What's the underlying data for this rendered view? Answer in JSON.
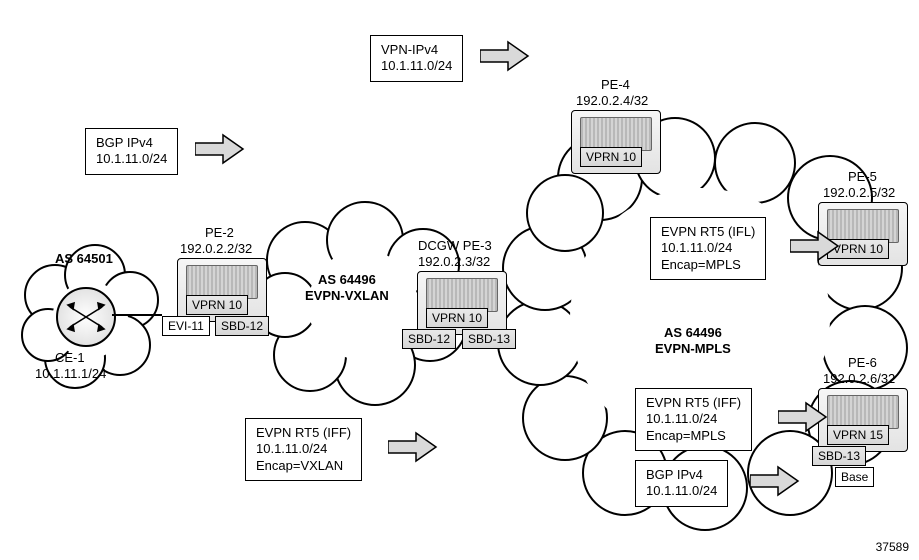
{
  "doc_id": "37589",
  "as": {
    "left": "AS 64501",
    "mid": "AS 64496\nEVPN-VXLAN",
    "right": "AS 64496\nEVPN-MPLS"
  },
  "nodes": {
    "ce1": {
      "name": "CE-1",
      "addr": "10.1.11.1/24"
    },
    "pe2": {
      "name": "PE-2",
      "addr": "192.0.2.2/32",
      "badges": {
        "vprn": "VPRN 10",
        "evi": "EVI-11",
        "sbd": "SBD-12"
      }
    },
    "pe3": {
      "name": "DCGW PE-3",
      "addr": "192.0.2.3/32",
      "badges": {
        "vprn": "VPRN 10",
        "sbd_l": "SBD-12",
        "sbd_r": "SBD-13"
      }
    },
    "pe4": {
      "name": "PE-4",
      "addr": "192.0.2.4/32",
      "badges": {
        "vprn": "VPRN 10"
      }
    },
    "pe5": {
      "name": "PE-5",
      "addr": "192.0.2.5/32",
      "badges": {
        "vprn": "VPRN 10"
      }
    },
    "pe6": {
      "name": "PE-6",
      "addr": "192.0.2.6/32",
      "badges": {
        "vprn": "VPRN 15",
        "sbd": "SBD-13",
        "base": "Base"
      }
    }
  },
  "routes": {
    "bgp_ipv4_left": {
      "l1": "BGP IPv4",
      "l2": "10.1.11.0/24"
    },
    "vpn_ipv4_top": {
      "l1": "VPN-IPv4",
      "l2": "10.1.11.0/24"
    },
    "evpn_vxlan": {
      "l1": "EVPN RT5 (IFF)",
      "l2": "10.1.11.0/24",
      "l3": "Encap=VXLAN"
    },
    "evpn_mpls_pe5": {
      "l1": "EVPN RT5 (IFL)",
      "l2": "10.1.11.0/24",
      "l3": "Encap=MPLS"
    },
    "evpn_mpls_pe6": {
      "l1": "EVPN RT5 (IFF)",
      "l2": "10.1.11.0/24",
      "l3": "Encap=MPLS"
    },
    "bgp_ipv4_pe6": {
      "l1": "BGP IPv4",
      "l2": "10.1.11.0/24"
    }
  }
}
